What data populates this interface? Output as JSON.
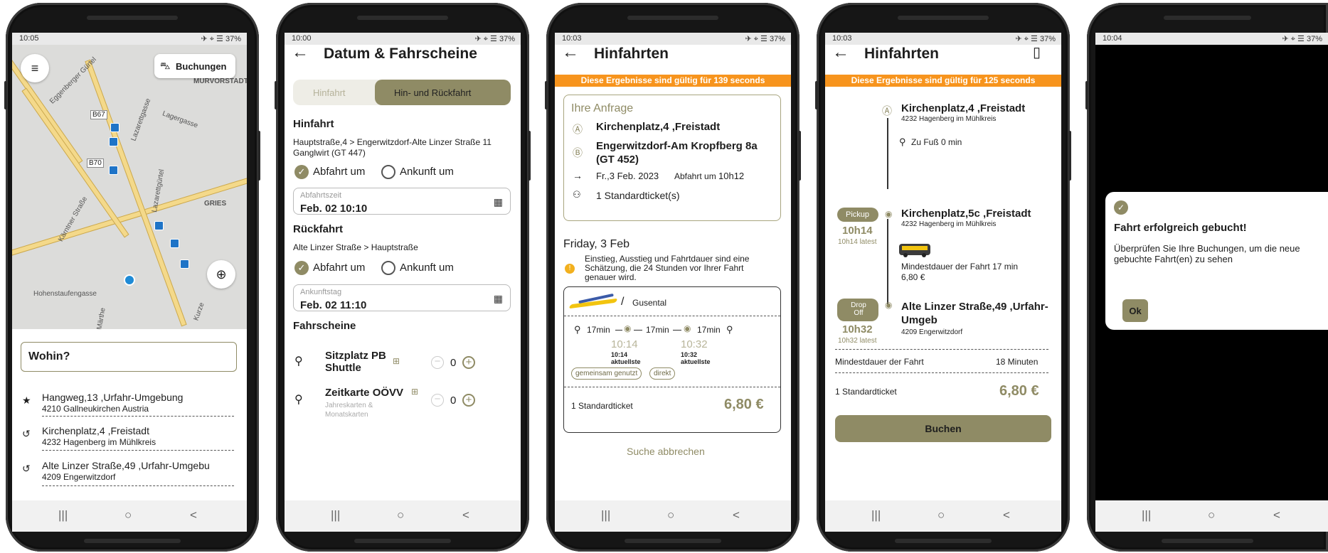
{
  "status": {
    "s1": "10:05",
    "s2": "10:00",
    "s3": "10:03",
    "s4": "10:03",
    "s5": "10:04",
    "battery": "37%"
  },
  "nav": {
    "recent": "|||",
    "home": "○",
    "back": "<"
  },
  "screen1": {
    "book_label": "Buchungen",
    "dest_placeholder": "Wohin?",
    "map_labels": [
      "Eggenberger Gürtel",
      "Lazarettgasse",
      "MURVORSTADT",
      "Lagergasse",
      "B67",
      "B70",
      "GRIES",
      "Kärntner Straße",
      "Lazarettgürtel",
      "Hohenstaufengasse",
      "Märthe",
      "Kurze"
    ],
    "items": [
      {
        "title": "Hangweg,13 ,Urfahr-Umgebung",
        "sub": "4210 Gallneukirchen Austria",
        "icon": "star"
      },
      {
        "title": "Kirchenplatz,4 ,Freistadt",
        "sub": "4232 Hagenberg im Mühlkreis",
        "icon": "history"
      },
      {
        "title": "Alte Linzer Straße,49 ,Urfahr-Umgebu",
        "sub": "4209 Engerwitzdorf",
        "icon": "history"
      }
    ]
  },
  "screen2": {
    "title": "Datum & Fahrscheine",
    "tab1": "Hinfahrt",
    "tab2": "Hin- und Rückfahrt",
    "hin_label": "Hinfahrt",
    "hin_route": "Hauptstraße,4 > Engerwitzdorf-Alte Linzer Straße 11 Ganglwirt (GT 447)",
    "abfahrt": "Abfahrt um",
    "ankunft": "Ankunft um",
    "abfahrt_field": "Abfahrtszeit",
    "abfahrt_value": "Feb. 02 10:10",
    "rueck_label": "Rückfahrt",
    "rueck_route": "Alte Linzer Straße > Hauptstraße",
    "ankunft_field": "Ankunftstag",
    "ankunft_value": "Feb. 02 11:10",
    "tickets_label": "Fahrscheine",
    "t1": "Sitzplatz PB Shuttle",
    "t1_qty": "0",
    "t2": "Zeitkarte OÖVV",
    "t2_sub": "Jahreskarten & Monatskarten",
    "t2_qty": "0"
  },
  "screen3": {
    "title": "Hinfahrten",
    "banner": "Diese Ergebnisse sind gültig für  139 seconds",
    "req_title": "Ihre Anfrage",
    "from": "Kirchenplatz,4 ,Freistadt",
    "to": "Engerwitzdorf-Am Kropfberg 8a (GT 452)",
    "date": "Fr.,3 Feb. 2023",
    "abf": "Abfahrt um",
    "abf_time": "10h12",
    "tickets": "1 Standardticket(s)",
    "day": "Friday, 3 Feb",
    "note": "Einstieg, Ausstieg und Fahrtdauer sind eine Schätzung, die 24 Stunden vor Ihrer Fahrt genauer wird.",
    "operator": "Gusental",
    "walk1": "17min",
    "ride": "17min",
    "walk2": "17min",
    "dep": "10:14",
    "dep_sub": "10:14",
    "dep_sub2": "aktuellste",
    "arr": "10:32",
    "arr_sub": "10:32",
    "arr_sub2": "aktuellste",
    "chip1": "gemeinsam genutzt",
    "chip2": "direkt",
    "ticket": "1 Standardticket",
    "price": "6,80 €",
    "cancel": "Suche abbrechen"
  },
  "screen4": {
    "title": "Hinfahrten",
    "banner": "Diese Ergebnisse sind gültig für  125 seconds",
    "a_title": "Kirchenplatz,4 ,Freistadt",
    "a_sub": "4232 Hagenberg im Mühlkreis",
    "walk": "Zu Fuß 0 min",
    "pickup": "Pickup",
    "p_time": "10h14",
    "p_latest": "10h14 latest",
    "p_title": "Kirchenplatz,5c ,Freistadt",
    "p_sub": "4232 Hagenberg im Mühlkreis",
    "min_dur": "Mindestdauer der Fahrt 17 min",
    "min_price": "6,80 €",
    "drop": "Drop Off",
    "d_time": "10h32",
    "d_latest": "10h32 latest",
    "d_title": "Alte Linzer Straße,49 ,Urfahr-Umgeb",
    "d_sub": "4209 Engerwitzdorf",
    "row1_l": "Mindestdauer der Fahrt",
    "row1_r": "18 Minuten",
    "row2_l": "1 Standardticket",
    "row2_r": "6,80 €",
    "book": "Buchen"
  },
  "screen5": {
    "title": "Fahrt erfolgreich gebucht!",
    "body": "Überprüfen Sie Ihre Buchungen, um die neue gebuchte Fahrt(en) zu sehen",
    "ok": "Ok"
  },
  "colors": {
    "olive": "#8f8b65",
    "orange": "#f7941d",
    "map": "#dcdcda",
    "route": "#f4d98a",
    "stop": "#1f74c7"
  }
}
